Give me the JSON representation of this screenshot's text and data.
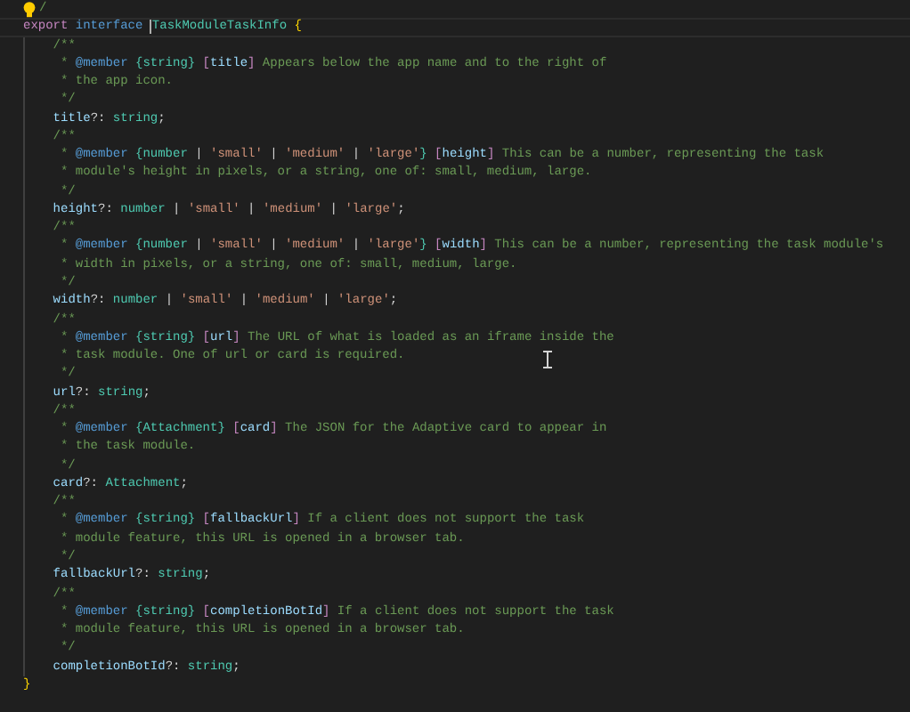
{
  "editor": {
    "hint_line": {
      "tokens": [
        {
          "kind": "com",
          "text": "/"
        }
      ]
    },
    "declaration": {
      "tokens": [
        {
          "kind": "ctl",
          "text": "export "
        },
        {
          "kind": "kw",
          "text": "interface "
        },
        {
          "kind": "type",
          "text": "TaskModuleTaskInfo",
          "caret": true
        },
        {
          "kind": "brace",
          "text": " {"
        }
      ],
      "body": [
        {
          "kind": "code",
          "tokens": [
            {
              "kind": "com",
              "text": "/**"
            }
          ]
        },
        {
          "kind": "doc",
          "tokens": [
            {
              "kind": "com",
              "text": "* "
            },
            {
              "kind": "tag",
              "text": "@member "
            },
            {
              "kind": "type",
              "text": "{string}"
            },
            {
              "kind": "ctl",
              "text": " ["
            },
            {
              "kind": "prop",
              "text": "title"
            },
            {
              "kind": "ctl",
              "text": "]"
            },
            {
              "kind": "com",
              "text": " Appears below the app name and to the right of"
            }
          ]
        },
        {
          "kind": "doc",
          "tokens": [
            {
              "kind": "com",
              "text": "* the app icon."
            }
          ]
        },
        {
          "kind": "doc",
          "tokens": [
            {
              "kind": "com",
              "text": "*/"
            }
          ]
        },
        {
          "kind": "code",
          "tokens": [
            {
              "kind": "prop",
              "text": "title"
            },
            {
              "kind": "punct",
              "text": "?: "
            },
            {
              "kind": "type",
              "text": "string"
            },
            {
              "kind": "punct",
              "text": ";"
            }
          ]
        },
        {
          "kind": "code",
          "tokens": [
            {
              "kind": "com",
              "text": "/**"
            }
          ]
        },
        {
          "kind": "doc",
          "tokens": [
            {
              "kind": "com",
              "text": "* "
            },
            {
              "kind": "tag",
              "text": "@member "
            },
            {
              "kind": "type",
              "text": "{number"
            },
            {
              "kind": "punct",
              "text": " | "
            },
            {
              "kind": "str",
              "text": "'small'"
            },
            {
              "kind": "punct",
              "text": " | "
            },
            {
              "kind": "str",
              "text": "'medium'"
            },
            {
              "kind": "punct",
              "text": " | "
            },
            {
              "kind": "str",
              "text": "'large'"
            },
            {
              "kind": "type",
              "text": "}"
            },
            {
              "kind": "ctl",
              "text": " ["
            },
            {
              "kind": "prop",
              "text": "height"
            },
            {
              "kind": "ctl",
              "text": "]"
            },
            {
              "kind": "com",
              "text": " This can be a number, representing the task"
            }
          ]
        },
        {
          "kind": "doc",
          "tokens": [
            {
              "kind": "com",
              "text": "* module's height in pixels, or a string, one of: small, medium, large."
            }
          ]
        },
        {
          "kind": "doc",
          "tokens": [
            {
              "kind": "com",
              "text": "*/"
            }
          ]
        },
        {
          "kind": "code",
          "tokens": [
            {
              "kind": "prop",
              "text": "height"
            },
            {
              "kind": "punct",
              "text": "?: "
            },
            {
              "kind": "type",
              "text": "number"
            },
            {
              "kind": "punct",
              "text": " | "
            },
            {
              "kind": "str",
              "text": "'small'"
            },
            {
              "kind": "punct",
              "text": " | "
            },
            {
              "kind": "str",
              "text": "'medium'"
            },
            {
              "kind": "punct",
              "text": " | "
            },
            {
              "kind": "str",
              "text": "'large'"
            },
            {
              "kind": "punct",
              "text": ";"
            }
          ]
        },
        {
          "kind": "code",
          "tokens": [
            {
              "kind": "com",
              "text": "/**"
            }
          ]
        },
        {
          "kind": "doc",
          "tokens": [
            {
              "kind": "com",
              "text": "* "
            },
            {
              "kind": "tag",
              "text": "@member "
            },
            {
              "kind": "type",
              "text": "{number"
            },
            {
              "kind": "punct",
              "text": " | "
            },
            {
              "kind": "str",
              "text": "'small'"
            },
            {
              "kind": "punct",
              "text": " | "
            },
            {
              "kind": "str",
              "text": "'medium'"
            },
            {
              "kind": "punct",
              "text": " | "
            },
            {
              "kind": "str",
              "text": "'large'"
            },
            {
              "kind": "type",
              "text": "}"
            },
            {
              "kind": "ctl",
              "text": " ["
            },
            {
              "kind": "prop",
              "text": "width"
            },
            {
              "kind": "ctl",
              "text": "]"
            },
            {
              "kind": "com",
              "text": " This can be a number, representing the task module's"
            }
          ]
        },
        {
          "kind": "doc",
          "tokens": [
            {
              "kind": "com",
              "text": "* width in pixels, or a string, one of: small, medium, large."
            }
          ]
        },
        {
          "kind": "doc",
          "tokens": [
            {
              "kind": "com",
              "text": "*/"
            }
          ]
        },
        {
          "kind": "code",
          "tokens": [
            {
              "kind": "prop",
              "text": "width"
            },
            {
              "kind": "punct",
              "text": "?: "
            },
            {
              "kind": "type",
              "text": "number"
            },
            {
              "kind": "punct",
              "text": " | "
            },
            {
              "kind": "str",
              "text": "'small'"
            },
            {
              "kind": "punct",
              "text": " | "
            },
            {
              "kind": "str",
              "text": "'medium'"
            },
            {
              "kind": "punct",
              "text": " | "
            },
            {
              "kind": "str",
              "text": "'large'"
            },
            {
              "kind": "punct",
              "text": ";"
            }
          ]
        },
        {
          "kind": "code",
          "tokens": [
            {
              "kind": "com",
              "text": "/**"
            }
          ]
        },
        {
          "kind": "doc",
          "tokens": [
            {
              "kind": "com",
              "text": "* "
            },
            {
              "kind": "tag",
              "text": "@member "
            },
            {
              "kind": "type",
              "text": "{string}"
            },
            {
              "kind": "ctl",
              "text": " ["
            },
            {
              "kind": "prop",
              "text": "url"
            },
            {
              "kind": "ctl",
              "text": "]"
            },
            {
              "kind": "com",
              "text": " The URL of what is loaded as an iframe inside the"
            }
          ]
        },
        {
          "kind": "doc",
          "tokens": [
            {
              "kind": "com",
              "text": "* task module. One of url or card is required."
            }
          ]
        },
        {
          "kind": "doc",
          "tokens": [
            {
              "kind": "com",
              "text": "*/"
            }
          ]
        },
        {
          "kind": "code",
          "tokens": [
            {
              "kind": "prop",
              "text": "url"
            },
            {
              "kind": "punct",
              "text": "?: "
            },
            {
              "kind": "type",
              "text": "string"
            },
            {
              "kind": "punct",
              "text": ";"
            }
          ]
        },
        {
          "kind": "code",
          "tokens": [
            {
              "kind": "com",
              "text": "/**"
            }
          ]
        },
        {
          "kind": "doc",
          "tokens": [
            {
              "kind": "com",
              "text": "* "
            },
            {
              "kind": "tag",
              "text": "@member "
            },
            {
              "kind": "type",
              "text": "{Attachment}"
            },
            {
              "kind": "ctl",
              "text": " ["
            },
            {
              "kind": "prop",
              "text": "card"
            },
            {
              "kind": "ctl",
              "text": "]"
            },
            {
              "kind": "com",
              "text": " The JSON for the Adaptive card to appear in"
            }
          ]
        },
        {
          "kind": "doc",
          "tokens": [
            {
              "kind": "com",
              "text": "* the task module."
            }
          ]
        },
        {
          "kind": "doc",
          "tokens": [
            {
              "kind": "com",
              "text": "*/"
            }
          ]
        },
        {
          "kind": "code",
          "tokens": [
            {
              "kind": "prop",
              "text": "card"
            },
            {
              "kind": "punct",
              "text": "?: "
            },
            {
              "kind": "type",
              "text": "Attachment"
            },
            {
              "kind": "punct",
              "text": ";"
            }
          ]
        },
        {
          "kind": "code",
          "tokens": [
            {
              "kind": "com",
              "text": "/**"
            }
          ]
        },
        {
          "kind": "doc",
          "tokens": [
            {
              "kind": "com",
              "text": "* "
            },
            {
              "kind": "tag",
              "text": "@member "
            },
            {
              "kind": "type",
              "text": "{string}"
            },
            {
              "kind": "ctl",
              "text": " ["
            },
            {
              "kind": "prop",
              "text": "fallbackUrl"
            },
            {
              "kind": "ctl",
              "text": "]"
            },
            {
              "kind": "com",
              "text": " If a client does not support the task"
            }
          ]
        },
        {
          "kind": "doc",
          "tokens": [
            {
              "kind": "com",
              "text": "* module feature, this URL is opened in a browser tab."
            }
          ]
        },
        {
          "kind": "doc",
          "tokens": [
            {
              "kind": "com",
              "text": "*/"
            }
          ]
        },
        {
          "kind": "code",
          "tokens": [
            {
              "kind": "prop",
              "text": "fallbackUrl"
            },
            {
              "kind": "punct",
              "text": "?: "
            },
            {
              "kind": "type",
              "text": "string"
            },
            {
              "kind": "punct",
              "text": ";"
            }
          ]
        },
        {
          "kind": "code",
          "tokens": [
            {
              "kind": "com",
              "text": "/**"
            }
          ]
        },
        {
          "kind": "doc",
          "tokens": [
            {
              "kind": "com",
              "text": "* "
            },
            {
              "kind": "tag",
              "text": "@member "
            },
            {
              "kind": "type",
              "text": "{string}"
            },
            {
              "kind": "ctl",
              "text": " ["
            },
            {
              "kind": "prop",
              "text": "completionBotId"
            },
            {
              "kind": "ctl",
              "text": "]"
            },
            {
              "kind": "com",
              "text": " If a client does not support the task"
            }
          ]
        },
        {
          "kind": "doc",
          "tokens": [
            {
              "kind": "com",
              "text": "* module feature, this URL is opened in a browser tab."
            }
          ]
        },
        {
          "kind": "doc",
          "tokens": [
            {
              "kind": "com",
              "text": "*/"
            }
          ]
        },
        {
          "kind": "code",
          "tokens": [
            {
              "kind": "prop",
              "text": "completionBotId"
            },
            {
              "kind": "punct",
              "text": "?: "
            },
            {
              "kind": "type",
              "text": "string"
            },
            {
              "kind": "punct",
              "text": ";"
            }
          ]
        }
      ],
      "closing": {
        "tokens": [
          {
            "kind": "brace",
            "text": "}"
          }
        ]
      }
    }
  }
}
